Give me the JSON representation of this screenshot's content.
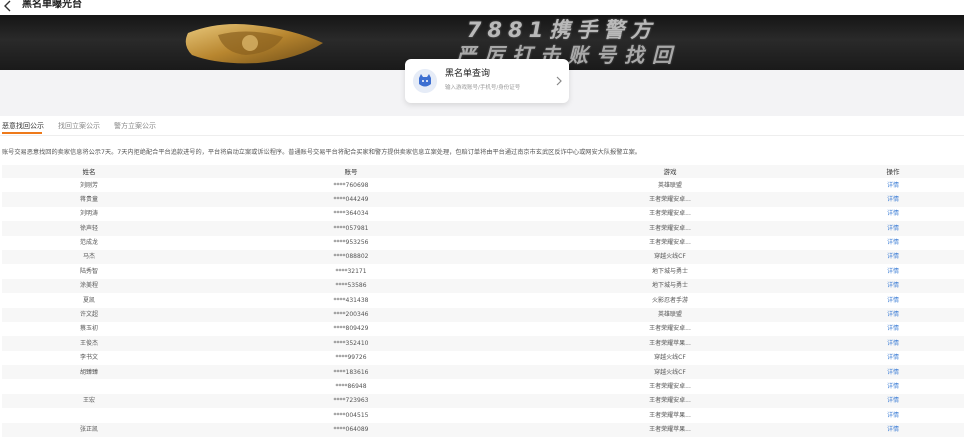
{
  "header": {
    "title": "黑名单曝光台"
  },
  "banner": {
    "line1": "7881携手警方",
    "line2": "严厉打击账号找回"
  },
  "query_card": {
    "title": "黑名单查询",
    "subtitle": "输入游戏账号/手机号/身份证号"
  },
  "tabs": [
    {
      "label": "恶意找回公示",
      "active": true
    },
    {
      "label": "找回立案公示",
      "active": false
    },
    {
      "label": "警方立案公示",
      "active": false
    }
  ],
  "notice": "账号交易恶意找回的卖家信息将公示7天。7天内拒绝配合平台追款进号的，平台将启动立案或诉讼程序。普通账号交易平台将配合买家和警方提供卖家信息立案处理，包赔订单将由平台通过南京市玄武区反诈中心或网安大队报警立案。",
  "table": {
    "columns": [
      "姓名",
      "账号",
      "游戏",
      "操作"
    ],
    "rows": [
      {
        "name": "刘刚芳",
        "account": "****760698",
        "game": "英雄联盟",
        "action": "详情"
      },
      {
        "name": "蒋贵童",
        "account": "****044249",
        "game": "王者荣耀安卓...",
        "action": "详情"
      },
      {
        "name": "刘明涛",
        "account": "****364034",
        "game": "王者荣耀安卓...",
        "action": "详情"
      },
      {
        "name": "徐声轻",
        "account": "****057981",
        "game": "王者荣耀安卓...",
        "action": "详情"
      },
      {
        "name": "范成龙",
        "account": "****953256",
        "game": "王者荣耀安卓...",
        "action": "详情"
      },
      {
        "name": "马杰",
        "account": "****088802",
        "game": "穿越火线CF",
        "action": "详情"
      },
      {
        "name": "陆秀智",
        "account": "****32171",
        "game": "地下城与勇士",
        "action": "详情"
      },
      {
        "name": "涂美程",
        "account": "****53586",
        "game": "地下城与勇士",
        "action": "详情"
      },
      {
        "name": "夏凯",
        "account": "****431438",
        "game": "火影忍者手游",
        "action": "详情"
      },
      {
        "name": "许文超",
        "account": "****200346",
        "game": "英雄联盟",
        "action": "详情"
      },
      {
        "name": "蔡玉初",
        "account": "****809429",
        "game": "王者荣耀安卓...",
        "action": "详情"
      },
      {
        "name": "王俊杰",
        "account": "****352410",
        "game": "王者荣耀苹果...",
        "action": "详情"
      },
      {
        "name": "李书文",
        "account": "****99726",
        "game": "穿越火线CF",
        "action": "详情"
      },
      {
        "name": "胡臻臻",
        "account": "****183616",
        "game": "穿越火线CF",
        "action": "详情"
      },
      {
        "name": "",
        "account": "****86948",
        "game": "王者荣耀安卓...",
        "action": "详情"
      },
      {
        "name": "王宏",
        "account": "****723963",
        "game": "王者荣耀安卓...",
        "action": "详情"
      },
      {
        "name": "",
        "account": "****004515",
        "game": "王者荣耀苹果...",
        "action": "详情"
      },
      {
        "name": "张正凯",
        "account": "****064089",
        "game": "王者荣耀苹果...",
        "action": "详情"
      }
    ]
  },
  "colors": {
    "accent": "#ee7a1b",
    "link": "#3f7fd6",
    "row_alt": "#f7f7f7"
  },
  "icons": {
    "back": "chevron-left-icon",
    "avatar": "cat-face-icon",
    "arrow": "chevron-right-icon",
    "shield": "police-badge-icon"
  }
}
